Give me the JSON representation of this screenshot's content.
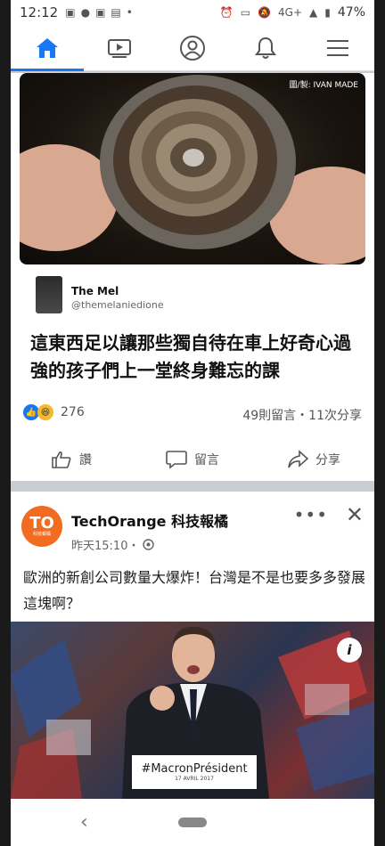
{
  "status_bar": {
    "time": "12:12",
    "network": "4G+",
    "battery": "47%"
  },
  "nav": {
    "items": [
      {
        "name": "home",
        "icon": "home-icon",
        "active": true
      },
      {
        "name": "watch",
        "icon": "video-icon",
        "active": false
      },
      {
        "name": "profile",
        "icon": "profile-icon",
        "active": false
      },
      {
        "name": "notifications",
        "icon": "bell-icon",
        "active": false
      },
      {
        "name": "menu",
        "icon": "hamburger-icon",
        "active": false
      }
    ],
    "accent": "#1877f2"
  },
  "post1": {
    "image_credit": "圖/製: IVAN MADE",
    "quote_author": "The Mel",
    "quote_handle": "@themelaniedione",
    "headline": "這東西足以讓那些獨自待在車上好奇心過強的孩子們上一堂終身難忘的課",
    "reaction_count": "276",
    "stats": "49則留言・11次分享",
    "actions": {
      "like": "讚",
      "comment": "留言",
      "share": "分享"
    }
  },
  "post2": {
    "page_name": "TechOrange 科技報橘",
    "avatar_text": "TO",
    "avatar_sub": "科技報橘",
    "time": "昨天15:10・",
    "text": "歐洲的新創公司數量大爆炸！台灣是不是也要多多發展這塊啊？",
    "image_sign": "#MacronPrésident",
    "image_date": "17 AVRIL 2017",
    "brand_color": "#f26b21"
  }
}
